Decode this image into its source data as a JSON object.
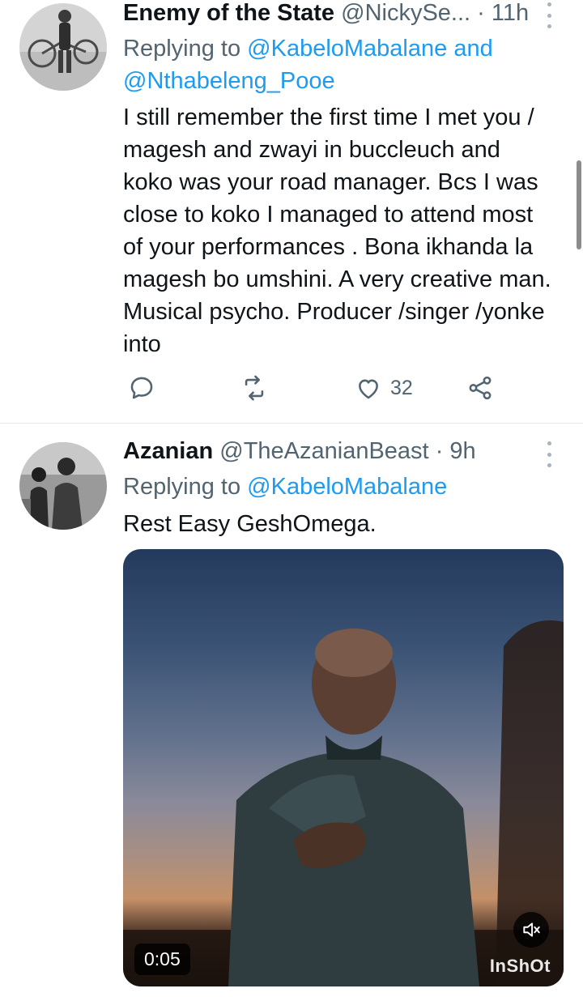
{
  "tweets": [
    {
      "name": "Enemy of the State",
      "handle": "@NickySe...",
      "dot": "·",
      "time": "11h",
      "replying_prefix": "Replying to",
      "mention1": "@KabeloMabalane",
      "joiner": "and",
      "mention2": "@Nthabeleng_Pooe",
      "body_lines": [
        "I still remember the first time I met you /",
        "magesh and zwayi in buccleuch and",
        "koko was your road manager. Bcs I was",
        "close to koko I managed to attend most",
        "of your performances . Bona ikhanda la",
        "magesh bo umshini. A very creative man.",
        "Musical psycho. Producer /singer /yonke",
        "into"
      ],
      "likes": "32"
    },
    {
      "name": "Azanian",
      "handle": "@TheAzanianBeast",
      "dot": "·",
      "time": "9h",
      "replying_prefix": "Replying to",
      "mention1": "@KabeloMabalane",
      "body": "Rest Easy GeshOmega.",
      "video": {
        "duration": "0:05",
        "watermark": "InShOt"
      }
    }
  ],
  "icons": {
    "reply": "reply-icon",
    "retweet": "retweet-icon",
    "like": "heart-icon",
    "share": "share-icon",
    "more": "more-vertical-icon",
    "mute": "mute-icon"
  },
  "colors": {
    "link": "#1d9bf0",
    "secondary": "#536471",
    "text": "#0f1419"
  }
}
